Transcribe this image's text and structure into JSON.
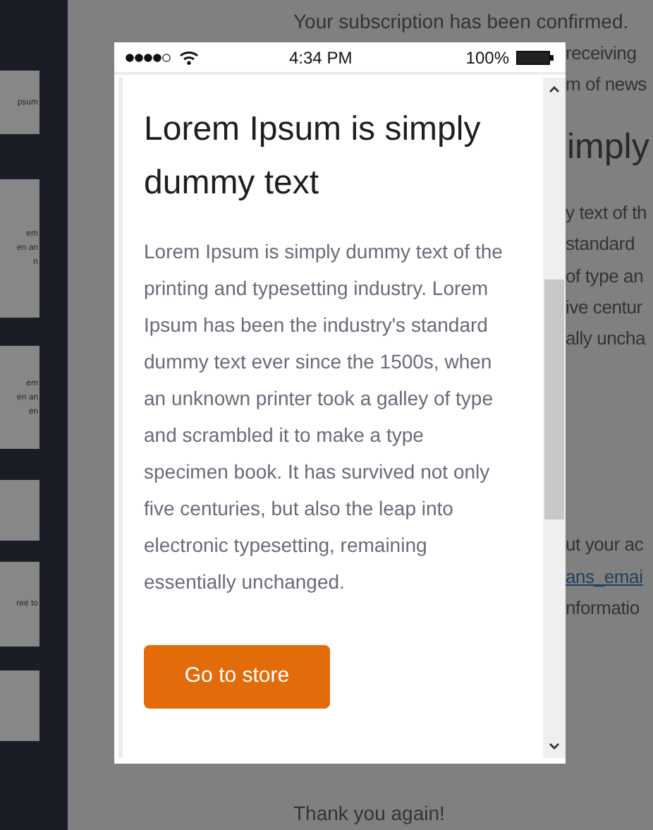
{
  "sidebar": {
    "cards": [
      {
        "kind": "text",
        "lines": [
          "psum"
        ]
      },
      {
        "kind": "text",
        "lines": [
          "em",
          "en an",
          "n"
        ]
      },
      {
        "kind": "text",
        "lines": [
          "em",
          "en an",
          "en"
        ]
      },
      {
        "kind": "blank"
      },
      {
        "kind": "text",
        "lines": [
          "ree to"
        ]
      },
      {
        "kind": "blank"
      }
    ]
  },
  "background": {
    "lines": [
      {
        "kind": "text",
        "text": "Your subscription has been confirmed."
      },
      {
        "kind": "fragment",
        "text": "receiving"
      },
      {
        "kind": "fragment",
        "text": "m of news"
      },
      {
        "kind": "heading",
        "text": "imply"
      },
      {
        "kind": "fragment",
        "text": "y text of th"
      },
      {
        "kind": "fragment",
        "text": "standard"
      },
      {
        "kind": "fragment",
        "text": "of type an"
      },
      {
        "kind": "fragment",
        "text": "ive centur"
      },
      {
        "kind": "fragment",
        "text": "ally uncha"
      },
      {
        "kind": "gap"
      },
      {
        "kind": "fragment",
        "text": "ut your ac"
      },
      {
        "kind": "link",
        "text": "ans_emai"
      },
      {
        "kind": "fragment",
        "text": "nformatio"
      },
      {
        "kind": "gap"
      },
      {
        "kind": "text",
        "text": "Thank you again!"
      }
    ]
  },
  "phone": {
    "status_bar": {
      "time": "4:34 PM",
      "battery": "100%"
    },
    "title": "Lorem Ipsum is simply dummy text",
    "body": "Lorem Ipsum is simply dummy text of the printing and typesetting industry. Lorem Ipsum has been the industry's standard dummy text ever since the 1500s, when an unknown printer took a galley of type and scrambled it to make a type specimen book. It has survived not only five centuries, but also the leap into electronic typesetting, remaining essentially unchanged.",
    "button": "Go to store"
  }
}
